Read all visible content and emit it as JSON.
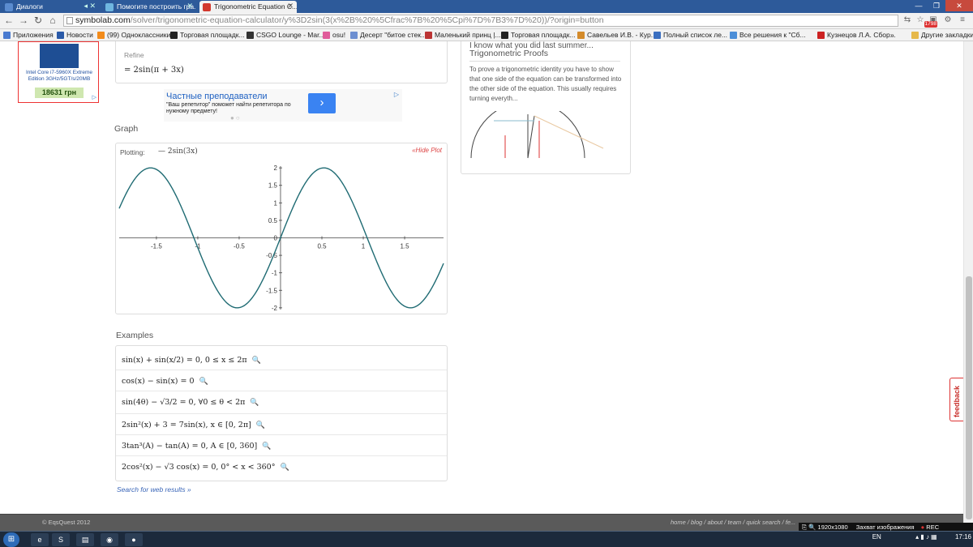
{
  "tabs": [
    {
      "label": "Диалоги",
      "active": false
    },
    {
      "label": "Помогите построить гра...",
      "active": false
    },
    {
      "label": "Trigonometric Equation C...",
      "active": true
    }
  ],
  "address": {
    "host": "symbolab.com",
    "path": "/solver/trigonometric-equation-calculator/y%3D2sin(3(x%2B%20%5Cfrac%7B%20%5Cpi%7D%7B3%7D%20))/?origin=button"
  },
  "toolbar_badge": "1798",
  "bookmarks": [
    "Приложения",
    "Новости",
    "(99) Одноклассники",
    "Торговая площадк...",
    "CSGO Lounge - Mar...",
    "osu!",
    "Десерт \"битое стек...",
    "Маленький принц |...",
    "Торговая площадк...",
    "Савельев И.В. - Кур...",
    "Полный список ле...",
    "Все решения к \"Сб...",
    "Кузнецов Л.А. Сбор...",
    "»",
    "Другие закладки"
  ],
  "left_ad": {
    "text": "Intel Core i7-5960X Extreme Edition 3GHz/5GT/s/20MB",
    "price": "18631 грн",
    "ad_mark": "▷"
  },
  "refine": {
    "label": "Refine",
    "math": "= 2sin(π + 3x)"
  },
  "tutor_ad": {
    "title": "Частные преподаватели",
    "body": "\"Ваш репетитор\" поможет найти репетитора по нужному предмету!",
    "arrow": "›",
    "ad_mark": "▷"
  },
  "graph": {
    "section_title": "Graph",
    "plotting_label": "Plotting:",
    "legend": "— 2sin(3x)",
    "hide_label": "«Hide Plot"
  },
  "chart_data": {
    "type": "line",
    "title": "",
    "series": [
      {
        "name": "2sin(3x)",
        "function": "2*sin(3*x)",
        "x_range": [
          -1.95,
          1.97
        ]
      }
    ],
    "xlim": [
      -1.95,
      1.97
    ],
    "ylim": [
      -2.05,
      2.05
    ],
    "x_ticks": [
      {
        "v": -1.5,
        "label": "-1.5"
      },
      {
        "v": -1,
        "label": "-1"
      },
      {
        "v": -0.5,
        "label": "-0.5"
      },
      {
        "v": 0,
        "label": "0"
      },
      {
        "v": 0.5,
        "label": "0.5"
      },
      {
        "v": 1,
        "label": "1"
      },
      {
        "v": 1.5,
        "label": "1.5"
      }
    ],
    "y_ticks": [
      {
        "v": 2,
        "label": "2"
      },
      {
        "v": 1.5,
        "label": "1.5"
      },
      {
        "v": 1,
        "label": "1"
      },
      {
        "v": 0.5,
        "label": "0.5"
      },
      {
        "v": 0,
        "label": "0"
      },
      {
        "v": -0.5,
        "label": "-0.5"
      },
      {
        "v": -1,
        "label": "-1"
      },
      {
        "v": -1.5,
        "label": "-1.5"
      },
      {
        "v": -2,
        "label": "-2"
      }
    ],
    "grid": false,
    "line_color": "#1f6b73"
  },
  "examples": {
    "section_title": "Examples",
    "items": [
      "sin(x) + sin(x/2) = 0, 0 ≤ x ≤ 2π",
      "cos(x) − sin(x) = 0",
      "sin(4θ) − √3/2 = 0, ∀0 ≤ θ < 2π",
      "2sin²(x) + 3 = 7sin(x), x ∈ [0, 2π]",
      "3tan³(A) − tan(A) = 0, A ∈ [0, 360]",
      "2cos²(x) − √3 cos(x) = 0, 0° < x < 360°"
    ],
    "search_web": "Search for web results »"
  },
  "right_card": {
    "header_cut": "I know what you did last summer...",
    "header": "Trigonometric Proofs",
    "description": "To prove a trigonometric identity you have to show that one side of the equation can be transformed into the other side of the equation. This usually requires turning everyth..."
  },
  "feedback_label": "feedback",
  "footer": {
    "copyright": "© EqsQuest 2012",
    "links": "home / blog / about / team / quick search / fe..."
  },
  "overlay": {
    "resolution": "1920x1080",
    "capture": "Захват изображения",
    "rec": "REC"
  },
  "taskbar": {
    "lang": "EN",
    "time": "17:16"
  },
  "colors": {
    "accent": "#c9302c",
    "link": "#3a66b8",
    "plot": "#1f6b73"
  }
}
